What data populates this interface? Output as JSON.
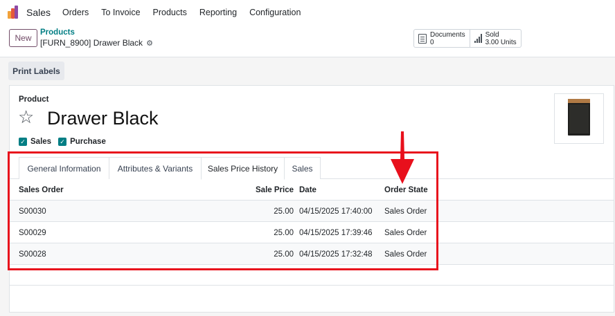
{
  "nav": {
    "app_name": "Sales",
    "items": [
      "Orders",
      "To Invoice",
      "Products",
      "Reporting",
      "Configuration"
    ]
  },
  "control": {
    "new_label": "New",
    "breadcrumb": "Products",
    "record_title": "[FURN_8900] Drawer Black",
    "smart_buttons": [
      {
        "label": "Documents",
        "value": "0",
        "icon": "document-icon"
      },
      {
        "label": "Sold",
        "value": "3.00 Units",
        "icon": "bar-chart-icon"
      }
    ]
  },
  "actions": {
    "print_labels": "Print Labels"
  },
  "form": {
    "product_label": "Product",
    "product_name": "Drawer Black",
    "checkboxes": [
      {
        "label": "Sales",
        "checked": true
      },
      {
        "label": "Purchase",
        "checked": true
      }
    ],
    "tabs": [
      "General Information",
      "Attributes & Variants",
      "Sales Price History",
      "Sales"
    ],
    "active_tab": "Sales Price History",
    "table": {
      "columns": [
        "Sales Order",
        "Sale Price",
        "Date",
        "Order State"
      ],
      "rows": [
        {
          "order": "S00030",
          "price": "25.00",
          "date": "04/15/2025 17:40:00",
          "state": "Sales Order"
        },
        {
          "order": "S00029",
          "price": "25.00",
          "date": "04/15/2025 17:39:46",
          "state": "Sales Order"
        },
        {
          "order": "S00028",
          "price": "25.00",
          "date": "04/15/2025 17:32:48",
          "state": "Sales Order"
        }
      ]
    }
  },
  "colors": {
    "brand": "#714B67",
    "accent": "#017e84",
    "annotation": "#e8101c"
  }
}
